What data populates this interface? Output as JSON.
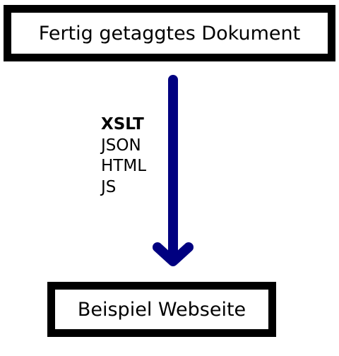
{
  "source_box": {
    "label": "Fertig getaggtes Dokument"
  },
  "target_box": {
    "label": "Beispiel Webseite"
  },
  "arrow": {
    "color": "#000080"
  },
  "transform_labels": [
    {
      "text": "XSLT",
      "bold": true
    },
    {
      "text": "JSON",
      "bold": false
    },
    {
      "text": "HTML",
      "bold": false
    },
    {
      "text": "JS",
      "bold": false
    }
  ]
}
